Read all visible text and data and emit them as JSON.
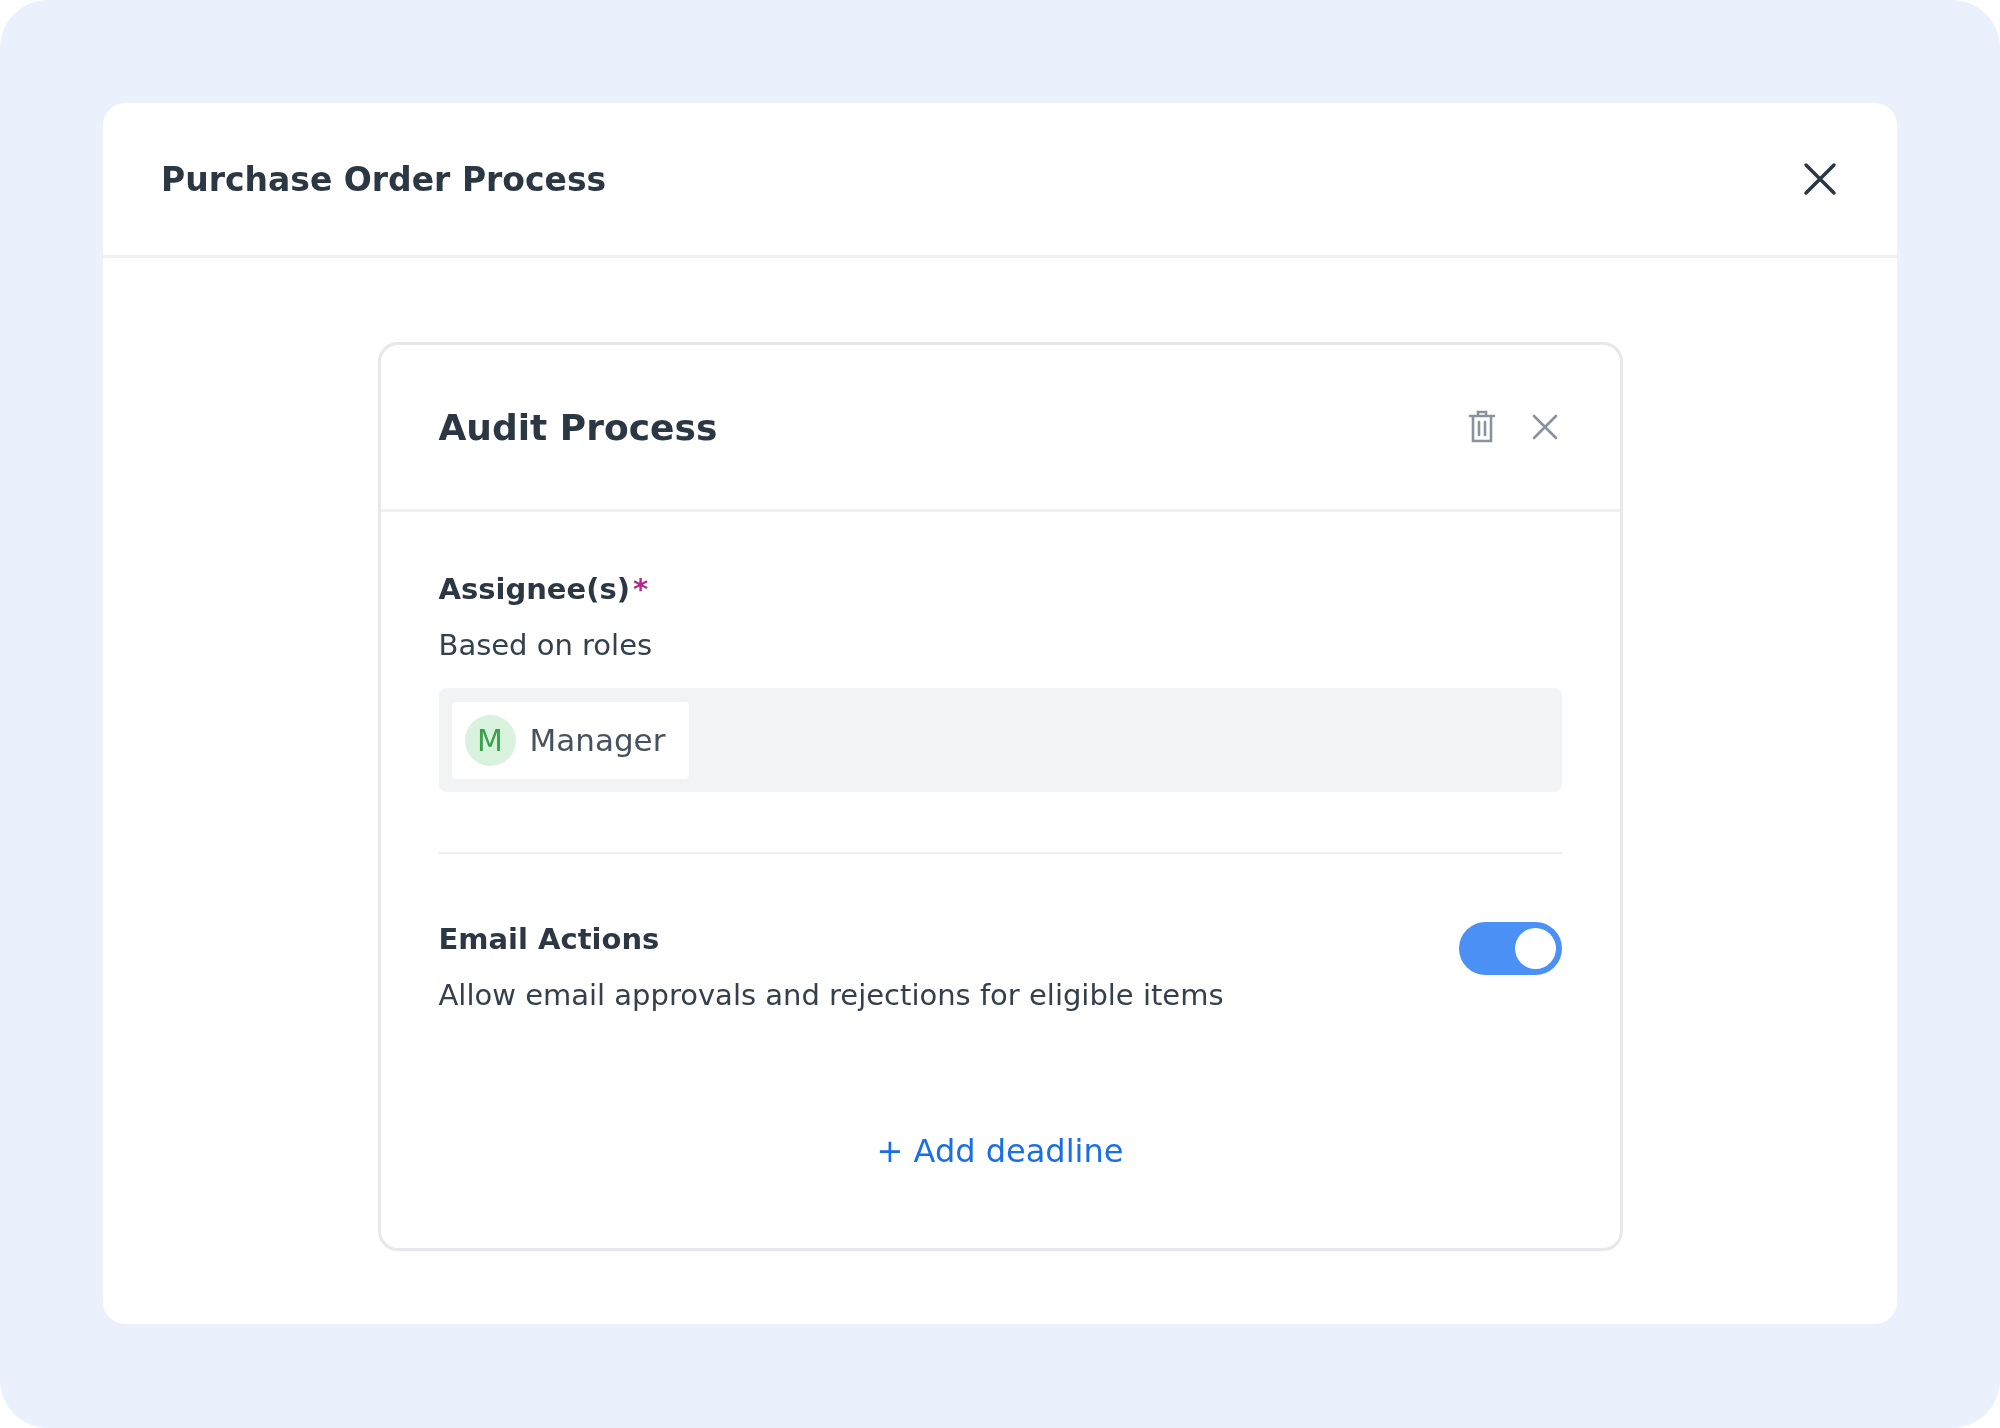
{
  "dialog": {
    "title": "Purchase Order Process"
  },
  "card": {
    "title": "Audit Process",
    "assignees": {
      "label": "Assignee(s)",
      "required": true,
      "required_mark": "*",
      "subtitle": "Based on roles",
      "chips": [
        {
          "initial": "M",
          "name": "Manager"
        }
      ]
    },
    "email_actions": {
      "label": "Email Actions",
      "description": "Allow email approvals and rejections for eligible items",
      "on": true
    },
    "add_deadline": "+ Add deadline"
  }
}
